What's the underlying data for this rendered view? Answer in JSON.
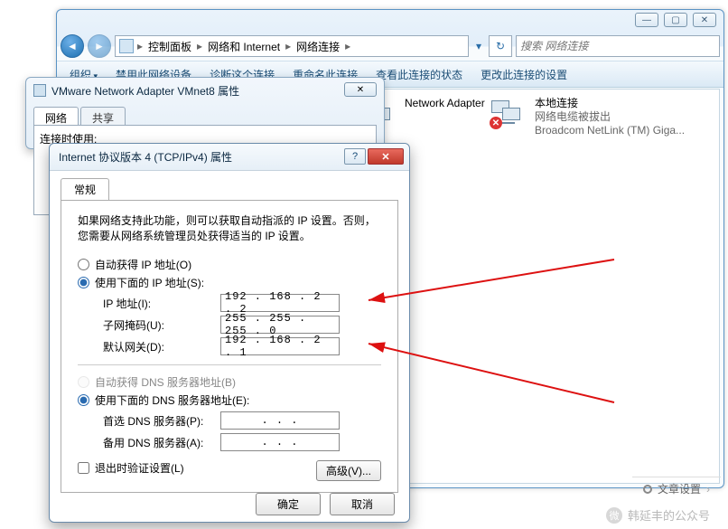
{
  "explorer": {
    "breadcrumb": [
      "控制面板",
      "网络和 Internet",
      "网络连接"
    ],
    "search_placeholder": "搜索 网络连接",
    "titlebar": {
      "min": "—",
      "max": "▢",
      "close": "✕"
    },
    "cmdbar": {
      "organize": "组织",
      "items": [
        "禁用此网络设备",
        "诊断这个连接",
        "重命名此连接",
        "查看此连接的状态",
        "更改此连接的设置"
      ]
    },
    "nets": {
      "vmnet": {
        "name": "Network Adapter",
        "prefix": ""
      },
      "local": {
        "name": "本地连接",
        "status": "网络电缆被拔出",
        "device": "Broadcom NetLink (TM) Giga..."
      }
    }
  },
  "dlg_mid": {
    "title": "VMware Network Adapter VMnet8 属性",
    "tabs": {
      "network": "网络",
      "share": "共享"
    },
    "connect_label": "连接时使用:"
  },
  "dlg_front": {
    "title": "Internet 协议版本 4 (TCP/IPv4) 属性",
    "tab_general": "常规",
    "desc": "如果网络支持此功能，则可以获取自动指派的 IP 设置。否则，您需要从网络系统管理员处获得适当的 IP 设置。",
    "radio_auto_ip": "自动获得 IP 地址(O)",
    "radio_manual_ip": "使用下面的 IP 地址(S):",
    "labels": {
      "ip": "IP 地址(I):",
      "mask": "子网掩码(U):",
      "gw": "默认网关(D):",
      "pri_dns": "首选 DNS 服务器(P):",
      "alt_dns": "备用 DNS 服务器(A):"
    },
    "values": {
      "ip": "192 . 168 .  2  .  2",
      "mask": "255 . 255 . 255 .  0",
      "gw": "192 . 168 .  2  .  1",
      "pri_dns": " .     .     . ",
      "alt_dns": " .     .     . "
    },
    "radio_auto_dns": "自动获得 DNS 服务器地址(B)",
    "radio_manual_dns": "使用下面的 DNS 服务器地址(E):",
    "chk_validate": "退出时验证设置(L)",
    "btn_adv": "高级(V)...",
    "btn_ok": "确定",
    "btn_cancel": "取消"
  },
  "watermark": "韩延丰的公众号",
  "article_settings": "文章设置"
}
